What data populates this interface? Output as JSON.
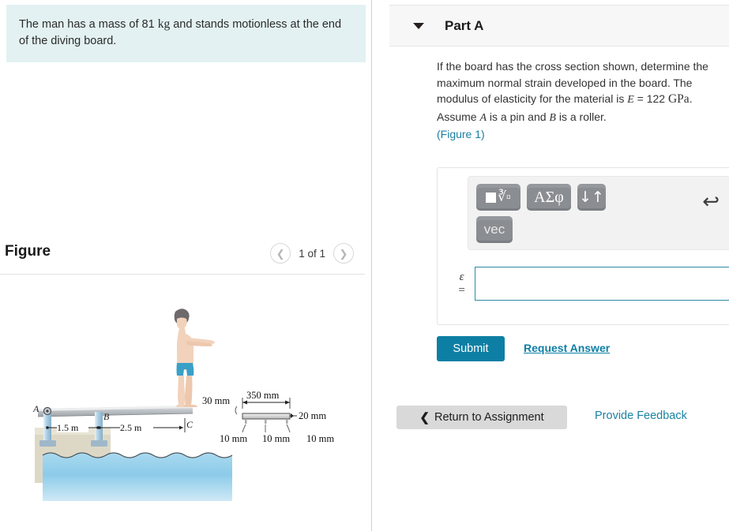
{
  "problem": {
    "text_before": "The man has a mass of 81 ",
    "unit": "kg",
    "text_after": " and stands motionless at the end of the diving board."
  },
  "figure_panel": {
    "title": "Figure",
    "prev_icon": "chevron-left-icon",
    "next_icon": "chevron-right-icon",
    "count_label": "1 of 1"
  },
  "figure": {
    "labels": {
      "a": "A",
      "b": "B",
      "c": "C",
      "span_ab": "1.5 m",
      "span_bc": "2.5 m",
      "width": "350 mm",
      "depth_left": "30 mm",
      "thickness": "20 mm",
      "t1": "10 mm",
      "t2": "10 mm",
      "t3": "10 mm"
    },
    "colors": {
      "water": "#8fcbe8",
      "support": "#bcd9ea",
      "deck": "#ddd7c4",
      "board": "#b9bcc0",
      "trunks": "#3aa0c8",
      "skin": "#f0cdb4"
    }
  },
  "part": {
    "caret_icon": "chevron-down-icon",
    "title": "Part A",
    "question": {
      "line1": "If the board has the cross section shown, determine the maximum normal strain developed in the board. The modulus of elasticity for the material is ",
      "E_symbol": "E",
      "E_equals": " = 122 ",
      "E_unit": "GPa",
      "line2": ". Assume ",
      "A_symbol": "A",
      "line3": " is a pin and ",
      "B_symbol": "B",
      "line4": " is a roller.",
      "figure_link": "(Figure 1)"
    }
  },
  "toolbar": {
    "template_button": "template-icon",
    "greek_button": "ΑΣφ",
    "arrows_button": "↓↑",
    "vec_button": "vec",
    "undo_icon": "undo-icon"
  },
  "answer": {
    "symbol": "ε",
    "equals": "=",
    "value": "",
    "placeholder": ""
  },
  "actions": {
    "submit_label": "Submit",
    "request_answer_label": "Request Answer",
    "return_label": "Return to Assignment",
    "return_icon": "chevron-left-icon",
    "feedback_label": "Provide Feedback"
  },
  "colors": {
    "accent": "#0e7fa4",
    "problem_bg": "#e3f1f2",
    "panel_bg": "#f7f7f7",
    "input_border": "#2d8aa5"
  }
}
